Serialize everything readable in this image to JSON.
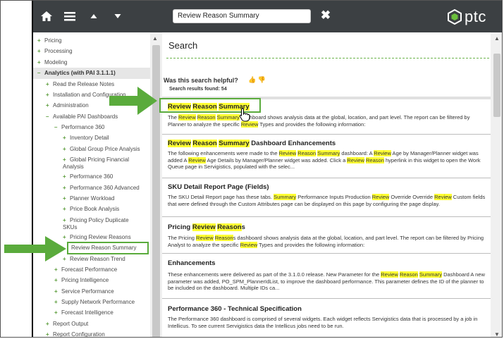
{
  "toolbar": {
    "search_value": "Review Reason Summary",
    "logo_text": "ptc"
  },
  "sidebar": {
    "items": [
      {
        "sign": "+",
        "label": "Pricing"
      },
      {
        "sign": "+",
        "label": "Processing"
      },
      {
        "sign": "+",
        "label": "Modeling"
      },
      {
        "sign": "–",
        "label": "Analytics (with PAI 3.1.1.1)"
      },
      {
        "sign": "+",
        "label": "Read the Release Notes"
      },
      {
        "sign": "+",
        "label": "Installation and Configuration"
      },
      {
        "sign": "+",
        "label": "Administration"
      },
      {
        "sign": "–",
        "label": "Available PAI Dashboards"
      },
      {
        "sign": "–",
        "label": "Performance 360"
      },
      {
        "sign": "+",
        "label": "Inventory Detail"
      },
      {
        "sign": "+",
        "label": "Global Group Price Analysis"
      },
      {
        "sign": "+",
        "label": "Global Pricing Financial Analysis"
      },
      {
        "sign": "+",
        "label": "Performance 360"
      },
      {
        "sign": "+",
        "label": "Performance 360 Advanced"
      },
      {
        "sign": "+",
        "label": "Planner Workload"
      },
      {
        "sign": "+",
        "label": "Price Book Analysis"
      },
      {
        "sign": "+",
        "label": "Pricing Policy Duplicate SKUs"
      },
      {
        "sign": "+",
        "label": "Pricing Review Reasons"
      },
      {
        "sign": "",
        "label": "Review Reason Summary"
      },
      {
        "sign": "+",
        "label": "Review Reason Trend"
      },
      {
        "sign": "+",
        "label": "Forecast Performance"
      },
      {
        "sign": "+",
        "label": "Pricing Intelligence"
      },
      {
        "sign": "+",
        "label": "Service Performance"
      },
      {
        "sign": "+",
        "label": "Supply Network Performance"
      },
      {
        "sign": "+",
        "label": "Forecast Intelligence"
      },
      {
        "sign": "+",
        "label": "Report Output"
      },
      {
        "sign": "+",
        "label": "Report Configuration"
      }
    ]
  },
  "main": {
    "title": "Search",
    "helpful_label": "Was this search helpful?",
    "results_label": "Search results found:",
    "results_count": "54"
  },
  "colors": {
    "highlight": "#ffff33",
    "accent_green": "#5aab3c",
    "topbar": "#3c4043"
  },
  "icons": [
    "home-icon",
    "hamburger-menu-icon",
    "arrow-up-icon",
    "arrow-down-icon",
    "clear-search-icon",
    "thumbs-up-icon",
    "thumbs-down-icon",
    "ptc-logo-icon",
    "pointer-hand-icon"
  ]
}
